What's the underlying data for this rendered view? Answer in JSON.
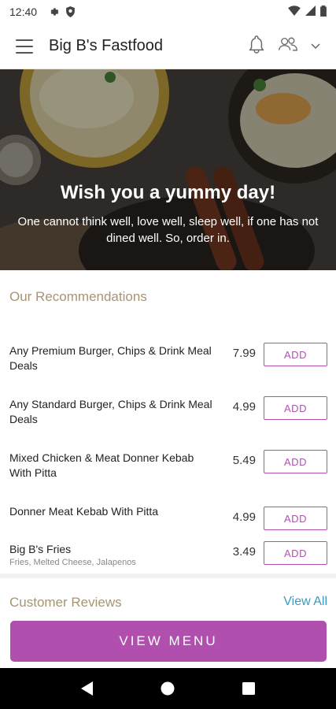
{
  "status": {
    "time": "12:40"
  },
  "app": {
    "title": "Big B's Fastfood"
  },
  "hero": {
    "heading": "Wish you a yummy day!",
    "subtext": "One cannot think well, love well, sleep well, if one has not dined well. So, order in."
  },
  "recommendations": {
    "title": "Our Recommendations",
    "add_label": "ADD",
    "items": [
      {
        "name": "Any Premium Burger, Chips & Drink Meal Deals",
        "price": "7.99",
        "description": ""
      },
      {
        "name": "Any Standard Burger, Chips & Drink Meal Deals",
        "price": "4.99",
        "description": ""
      },
      {
        "name": "Mixed Chicken & Meat Donner Kebab With Pitta",
        "price": "5.49",
        "description": ""
      },
      {
        "name": "Donner Meat Kebab With Pitta",
        "price": "4.99",
        "description": ""
      },
      {
        "name": "Big B's Fries",
        "price": "3.49",
        "description": "Fries, Melted Cheese, Jalapenos"
      }
    ]
  },
  "reviews": {
    "title": "Customer Reviews",
    "view_all": "View All"
  },
  "cta": {
    "view_menu": "VIEW MENU"
  },
  "colors": {
    "accent": "#b04fae",
    "section_title": "#a89570",
    "link": "#3a9abf"
  },
  "icons": [
    "settings-icon",
    "shield-icon",
    "wifi-icon",
    "signal-icon",
    "battery-icon",
    "menu-icon",
    "bell-icon",
    "users-icon",
    "chevron-down-icon",
    "back-icon",
    "home-icon",
    "recents-icon"
  ]
}
